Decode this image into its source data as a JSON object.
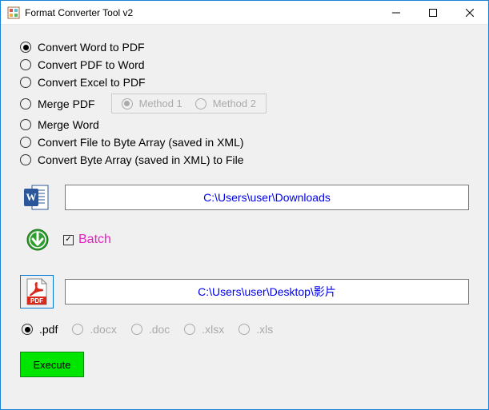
{
  "window": {
    "title": "Format Converter Tool v2"
  },
  "options": {
    "selected": 0,
    "items": [
      "Convert Word to PDF",
      "Convert PDF to Word",
      "Convert Excel to PDF",
      "Merge PDF",
      "Merge Word",
      "Convert File to Byte Array (saved in XML)",
      "Convert Byte Array (saved in XML) to File"
    ]
  },
  "methods": {
    "enabled": false,
    "selected": 0,
    "items": [
      "Method 1",
      "Method 2"
    ]
  },
  "paths": {
    "source": "C:\\Users\\user\\Downloads",
    "dest": "C:\\Users\\user\\Desktop\\影片"
  },
  "batch": {
    "checked": true,
    "label": "Batch"
  },
  "extensions": {
    "selected": 0,
    "items": [
      ".pdf",
      ".docx",
      ".doc",
      ".xlsx",
      ".xls"
    ],
    "enabled": [
      true,
      false,
      false,
      false,
      false
    ]
  },
  "execute": {
    "label": "Execute"
  }
}
